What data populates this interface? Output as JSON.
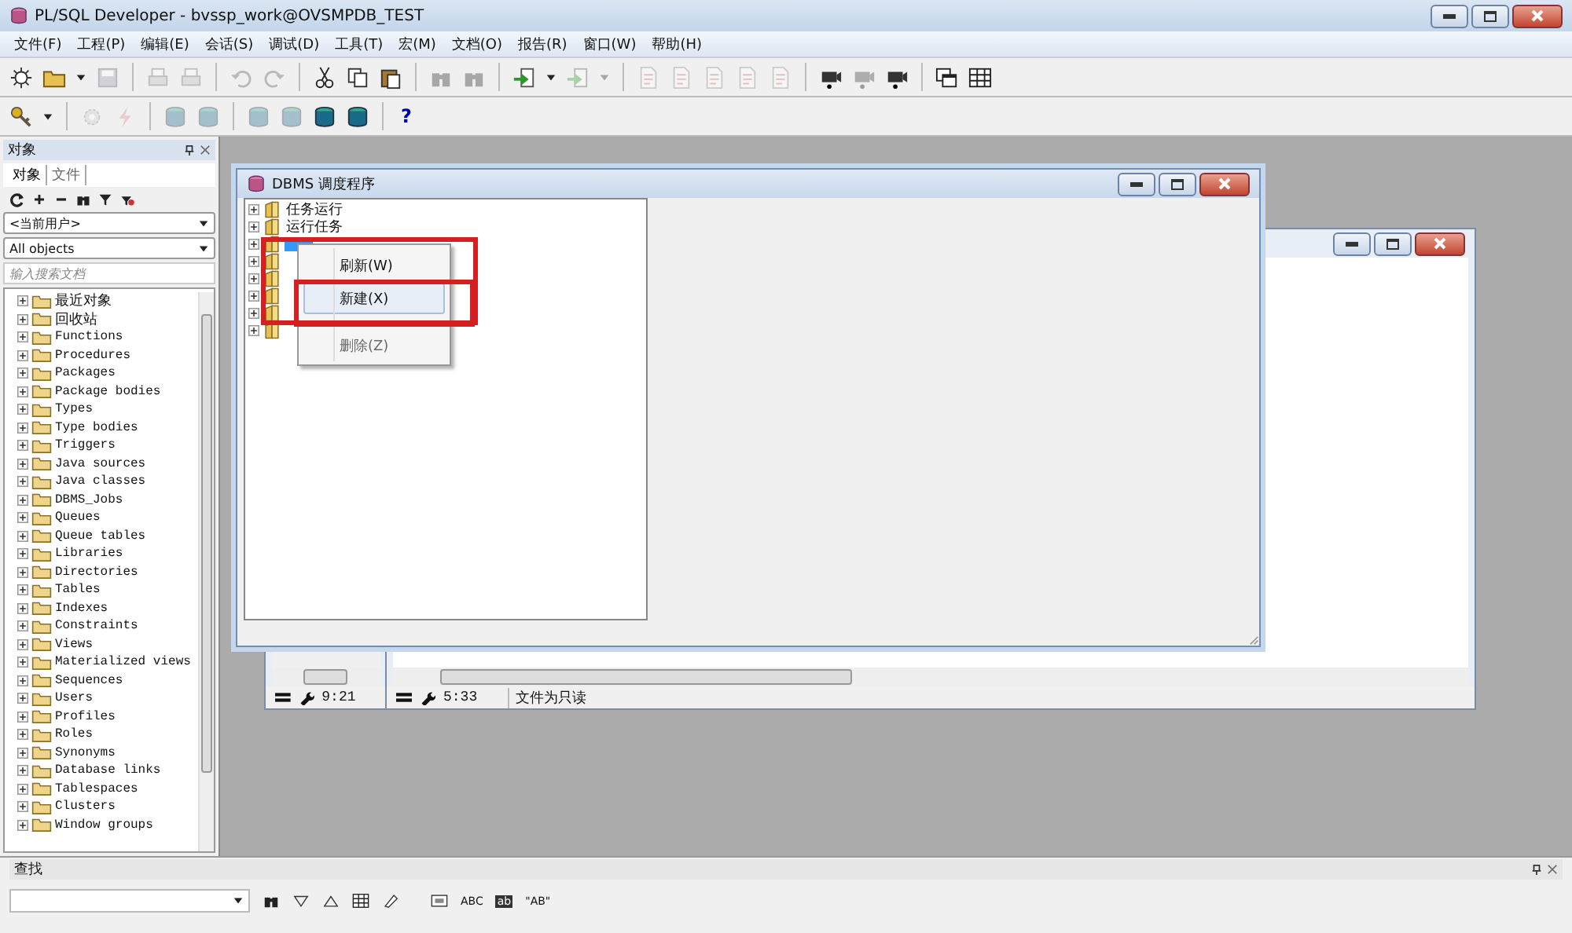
{
  "window": {
    "title": "PL/SQL Developer - bvssp_work@OVSMPDB_TEST"
  },
  "menu": [
    "文件(F)",
    "工程(P)",
    "编辑(E)",
    "会话(S)",
    "调试(D)",
    "工具(T)",
    "宏(M)",
    "文档(O)",
    "报告(R)",
    "窗口(W)",
    "帮助(H)"
  ],
  "toolbar_1": [
    {
      "kind": "sparkle",
      "disabled": false
    },
    {
      "kind": "folder",
      "disabled": false
    },
    {
      "kind": "caret",
      "disabled": false
    },
    {
      "kind": "disk",
      "disabled": true
    },
    {
      "kind": "sep"
    },
    {
      "kind": "printer",
      "disabled": true
    },
    {
      "kind": "printer",
      "disabled": true
    },
    {
      "kind": "sep"
    },
    {
      "kind": "undo",
      "disabled": true
    },
    {
      "kind": "redo",
      "disabled": true
    },
    {
      "kind": "sep"
    },
    {
      "kind": "scissors",
      "disabled": false
    },
    {
      "kind": "copy",
      "disabled": false
    },
    {
      "kind": "paste",
      "disabled": false
    },
    {
      "kind": "sep"
    },
    {
      "kind": "binoculars",
      "disabled": true
    },
    {
      "kind": "binoculars",
      "disabled": true
    },
    {
      "kind": "sep"
    },
    {
      "kind": "import",
      "disabled": false
    },
    {
      "kind": "caret",
      "disabled": false
    },
    {
      "kind": "import",
      "disabled": true
    },
    {
      "kind": "caret",
      "disabled": true
    },
    {
      "kind": "sep"
    },
    {
      "kind": "document",
      "disabled": true
    },
    {
      "kind": "document",
      "disabled": true
    },
    {
      "kind": "document",
      "disabled": true
    },
    {
      "kind": "document",
      "disabled": true
    },
    {
      "kind": "document",
      "disabled": true
    },
    {
      "kind": "sep"
    },
    {
      "kind": "camera",
      "disabled": false
    },
    {
      "kind": "camera",
      "disabled": true
    },
    {
      "kind": "camera",
      "disabled": false
    },
    {
      "kind": "sep"
    },
    {
      "kind": "windows",
      "disabled": false
    },
    {
      "kind": "grid",
      "disabled": false
    }
  ],
  "toolbar_2": [
    {
      "kind": "key",
      "disabled": false
    },
    {
      "kind": "caret",
      "disabled": false
    },
    {
      "kind": "sep"
    },
    {
      "kind": "gear",
      "disabled": true
    },
    {
      "kind": "lightning",
      "disabled": true
    },
    {
      "kind": "sep"
    },
    {
      "kind": "database",
      "disabled": true
    },
    {
      "kind": "database",
      "disabled": true
    },
    {
      "kind": "sep"
    },
    {
      "kind": "database",
      "disabled": true
    },
    {
      "kind": "database",
      "disabled": true
    },
    {
      "kind": "database",
      "disabled": false
    },
    {
      "kind": "database",
      "disabled": false
    },
    {
      "kind": "sep"
    },
    {
      "kind": "help",
      "label": "?",
      "disabled": false
    }
  ],
  "object_panel": {
    "title": "对象",
    "tabs": [
      {
        "label": "对象",
        "selected": true
      },
      {
        "label": "文件",
        "selected": false
      }
    ],
    "owner_combo": "<当前用户>",
    "filter_combo": "All objects",
    "search": {
      "placeholder": "输入搜索文档"
    },
    "tree": [
      "最近对象",
      "回收站",
      "Functions",
      "Procedures",
      "Packages",
      "Package bodies",
      "Types",
      "Type bodies",
      "Triggers",
      "Java sources",
      "Java classes",
      "DBMS_Jobs",
      "Queues",
      "Queue tables",
      "Libraries",
      "Directories",
      "Tables",
      "Indexes",
      "Constraints",
      "Views",
      "Materialized views",
      "Sequences",
      "Users",
      "Profiles",
      "Roles",
      "Synonyms",
      "Database links",
      "Tablespaces",
      "Clusters",
      "Window groups"
    ]
  },
  "back_windows": [
    {
      "status_time": "9:21"
    },
    {
      "status_time": "5:33",
      "status_text": "文件为只读"
    }
  ],
  "dialog": {
    "title": "DBMS 调度程序",
    "tree": [
      {
        "label": "任务运行",
        "selected": false
      },
      {
        "label": "运行任务",
        "selected": false
      },
      {
        "selected": true
      },
      {
        "selected": false
      },
      {
        "selected": false
      },
      {
        "selected": false
      },
      {
        "selected": false
      },
      {
        "selected": false
      }
    ],
    "context_menu": {
      "highlighted": true,
      "items": [
        {
          "label": "刷新(W)",
          "selected": false,
          "disabled": false,
          "highlighted": false
        },
        {
          "label": "新建(X)",
          "selected": true,
          "disabled": false,
          "highlighted": true
        },
        {
          "label": "删除(Z)",
          "selected": false,
          "disabled": true,
          "highlighted": false
        }
      ]
    }
  },
  "find_panel": {
    "title": "查找",
    "tools": [
      {
        "kind": "binoculars"
      },
      {
        "kind": "down"
      },
      {
        "kind": "up"
      },
      {
        "kind": "grid"
      },
      {
        "kind": "eraser"
      },
      {
        "kind": "sep"
      },
      {
        "kind": "field"
      },
      {
        "kind": "text",
        "label": "ABC"
      },
      {
        "kind": "textbox",
        "label": "ab"
      },
      {
        "kind": "text",
        "label": "\"AB\""
      }
    ]
  }
}
